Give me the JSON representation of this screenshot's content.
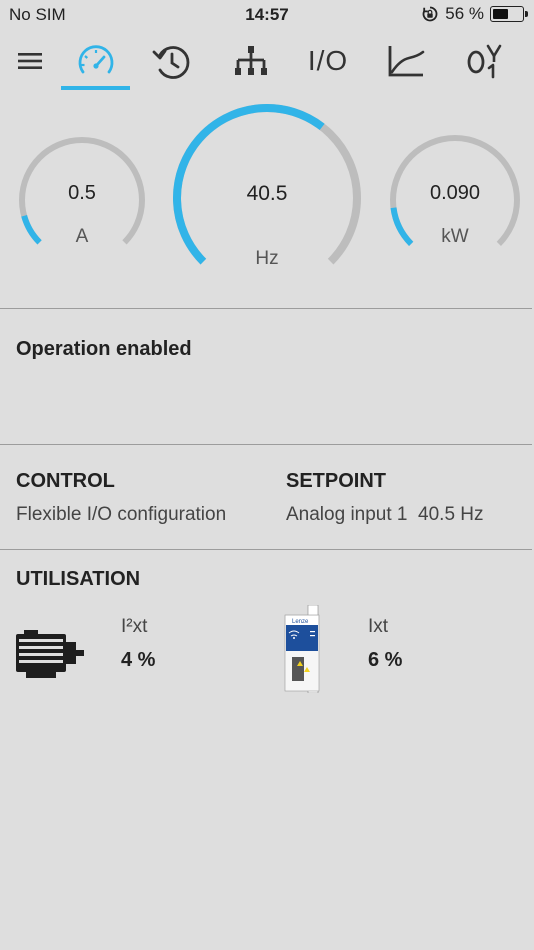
{
  "statusbar": {
    "carrier": "No SIM",
    "time": "14:57",
    "battery_text": "56 %",
    "battery_level": 0.56,
    "icons": [
      "orientation-lock-icon",
      "battery-icon"
    ]
  },
  "toolbar": {
    "active_tab": "dashboard",
    "accent_color": "#31b4e8",
    "tabs": [
      {
        "name": "menu",
        "icon": "hamburger-menu-icon"
      },
      {
        "name": "dashboard",
        "icon": "speedometer-icon"
      },
      {
        "name": "history",
        "icon": "history-icon"
      },
      {
        "name": "network",
        "icon": "network-tree-icon"
      },
      {
        "name": "io",
        "label": "I/O"
      },
      {
        "name": "trend",
        "icon": "line-chart-icon"
      },
      {
        "name": "parameters",
        "icon": "digital-signal-icon"
      }
    ]
  },
  "gauges": {
    "current": {
      "value": "0.5",
      "unit": "A",
      "fill_fraction": 0.11
    },
    "frequency": {
      "value": "40.5",
      "unit": "Hz",
      "fill_fraction": 0.64
    },
    "power": {
      "value": "0.090",
      "unit": "kW",
      "fill_fraction": 0.14
    }
  },
  "status": {
    "text": "Operation enabled"
  },
  "control": {
    "heading": "CONTROL",
    "value": "Flexible I/O configuration"
  },
  "setpoint": {
    "heading": "SETPOINT",
    "value": "Analog input 1  40.5 Hz"
  },
  "utilisation": {
    "heading": "UTILISATION",
    "motor": {
      "label": "I²xt",
      "value": "4 %",
      "icon": "motor-icon"
    },
    "inverter": {
      "label": "Ixt",
      "value": "6 %",
      "icon": "inverter-device-icon",
      "brand_text": "Lenze"
    }
  }
}
